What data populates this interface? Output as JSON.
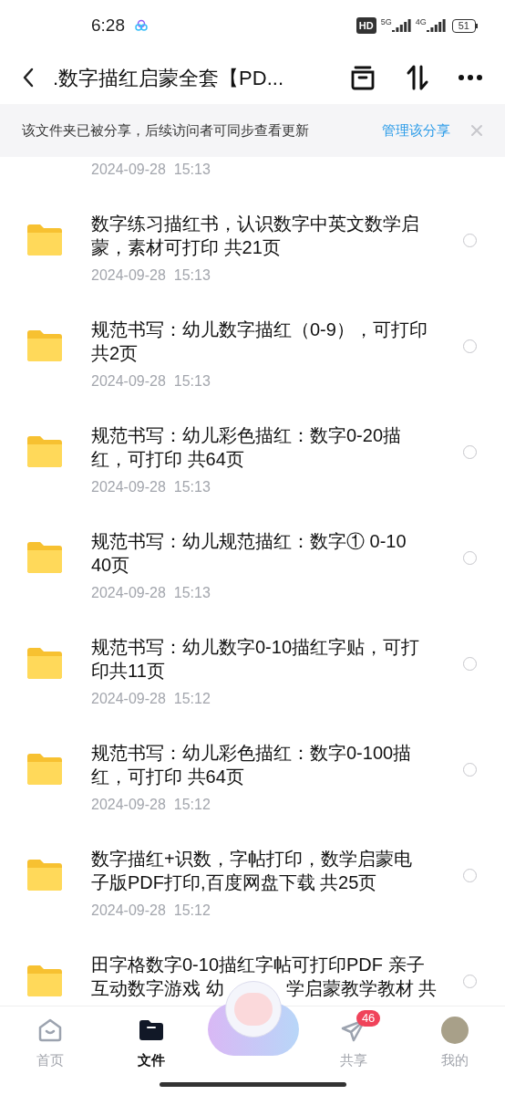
{
  "status_bar": {
    "time": "6:28",
    "hd": "HD",
    "net1": "5G",
    "net2": "4G",
    "battery": "51"
  },
  "header": {
    "title": ".数字描红启蒙全套【PD..."
  },
  "banner": {
    "text": "该文件夹已被分享，后续访问者可同步查看更新",
    "action": "管理该分享"
  },
  "files": [
    {
      "date": "2024-09-28  15:13"
    },
    {
      "title": "数字练习描红书，认识数字中英文数学启蒙，素材可打印 共21页",
      "date": "2024-09-28  15:13",
      "selected": false
    },
    {
      "title": "规范书写：幼儿数字描红（0-9），可打印共2页",
      "date": "2024-09-28  15:13",
      "selected": false
    },
    {
      "title": "规范书写：幼儿彩色描红：数字0-20描红，可打印 共64页",
      "date": "2024-09-28  15:13",
      "selected": false
    },
    {
      "title": "规范书写：幼儿规范描红：数字① 0-10 40页",
      "date": "2024-09-28  15:13",
      "selected": false
    },
    {
      "title": "规范书写：幼儿数字0-10描红字贴，可打印共11页",
      "date": "2024-09-28  15:12",
      "selected": false
    },
    {
      "title": "规范书写：幼儿彩色描红：数字0-100描红，可打印 共64页",
      "date": "2024-09-28  15:12",
      "selected": false
    },
    {
      "title": "数字描红+识数，字帖打印，数学启蒙电子版PDF打印,百度网盘下载 共25页",
      "date": "2024-09-28  15:12",
      "selected": false
    },
    {
      "title": "田字格数字0-10描红字帖可打印PDF 亲子",
      "title_continued": [
        "互动数字游戏 幼",
        "学启蒙教学教材 共"
      ],
      "selected": false
    }
  ],
  "nav": [
    {
      "label": "首页",
      "selected": false,
      "kind": "home"
    },
    {
      "label": "文件",
      "selected": true,
      "kind": "files"
    },
    {
      "label": "共享",
      "selected": false,
      "kind": "share",
      "badge": "46"
    },
    {
      "label": "我的",
      "selected": false,
      "kind": "me"
    }
  ]
}
